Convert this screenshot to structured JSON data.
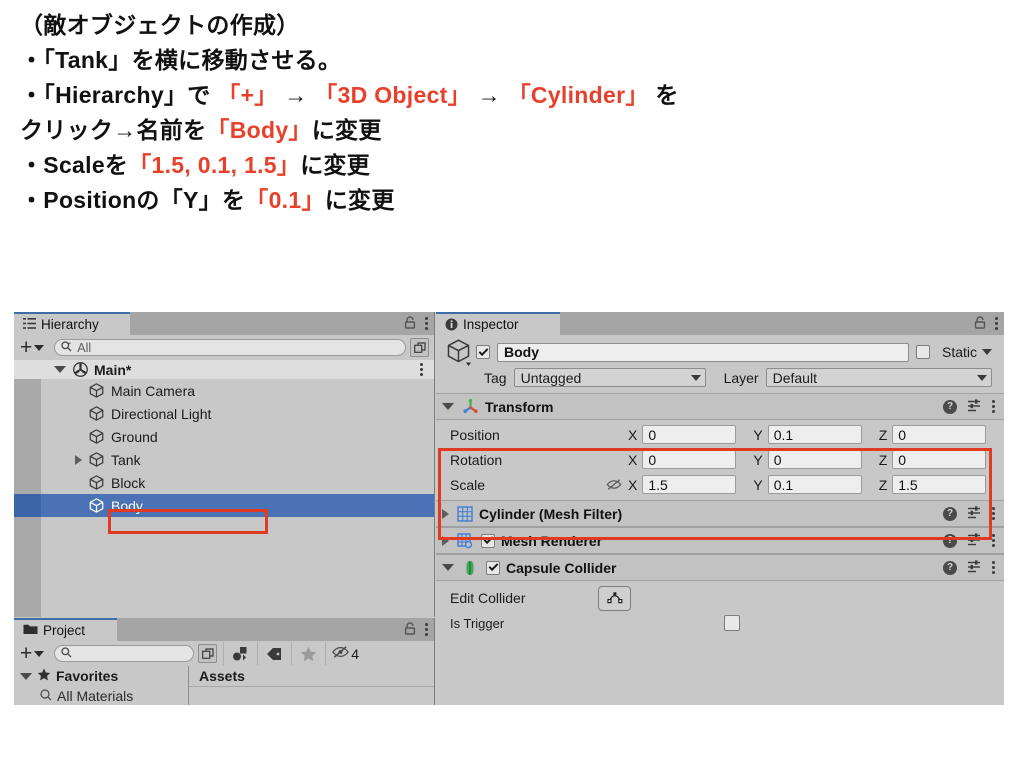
{
  "slide": {
    "lines": [
      [
        {
          "t": "（敵オブジェクトの作成）",
          "c": "black"
        }
      ],
      [
        {
          "t": "・「Tank」を横に移動させる。",
          "c": "black"
        }
      ],
      [
        {
          "t": "・「Hierarchy」で ",
          "c": "black"
        },
        {
          "t": "「+」",
          "c": "red"
        },
        {
          "t": " → ",
          "c": "black"
        },
        {
          "t": "「3D Object」",
          "c": "red"
        },
        {
          "t": " → ",
          "c": "black"
        },
        {
          "t": "「Cylinder」",
          "c": "red"
        },
        {
          "t": " を",
          "c": "black"
        }
      ],
      [
        {
          "t": "クリック→名前を",
          "c": "black"
        },
        {
          "t": "「Body」",
          "c": "red"
        },
        {
          "t": "に変更",
          "c": "black"
        }
      ],
      [
        {
          "t": "・Scaleを",
          "c": "black"
        },
        {
          "t": "「1.5, 0.1, 1.5」",
          "c": "red"
        },
        {
          "t": "に変更",
          "c": "black"
        }
      ],
      [
        {
          "t": "・Positionの「Y」を",
          "c": "black"
        },
        {
          "t": "「0.1」",
          "c": "red"
        },
        {
          "t": "に変更",
          "c": "black"
        }
      ]
    ],
    "accent_red": "#e8402a",
    "text_color": "#111111"
  },
  "hierarchy": {
    "tab_label": "Hierarchy",
    "tab_icon": "hierarchy-icon",
    "lock_icon": "lock-icon",
    "menu_icon": "kebab-menu-icon",
    "add_label": "+",
    "search_placeholder": "All",
    "search_icon": "search-icon",
    "expand_icon": "expand-window-icon",
    "scene": {
      "name": "Main*",
      "icon": "unity-scene-icon",
      "expanded": true
    },
    "items": [
      {
        "label": "Main Camera",
        "icon": "gameobject-cube-icon",
        "indent": 2,
        "arrow": false,
        "selected": false
      },
      {
        "label": "Directional Light",
        "icon": "gameobject-cube-icon",
        "indent": 2,
        "arrow": false,
        "selected": false
      },
      {
        "label": "Ground",
        "icon": "gameobject-cube-icon",
        "indent": 2,
        "arrow": false,
        "selected": false
      },
      {
        "label": "Tank",
        "icon": "gameobject-cube-icon",
        "indent": 2,
        "arrow": true,
        "selected": false
      },
      {
        "label": "Block",
        "icon": "gameobject-cube-icon",
        "indent": 2,
        "arrow": false,
        "selected": false
      },
      {
        "label": "Body",
        "icon": "gameobject-cube-icon",
        "indent": 2,
        "arrow": false,
        "selected": true
      }
    ],
    "selection_color": "#4a72b5",
    "highlight_box_color": "#e03a20"
  },
  "project": {
    "tab_label": "Project",
    "tab_icon": "folder-icon",
    "lock_icon": "lock-icon",
    "menu_icon": "kebab-menu-icon",
    "add_label": "+",
    "search_placeholder": "",
    "search_icon": "search-icon",
    "expand_icon": "expand-window-icon",
    "filter_buttons": [
      {
        "icon": "asset-type-filter-icon",
        "label": ""
      },
      {
        "icon": "label-tag-filter-icon",
        "label": ""
      },
      {
        "icon": "star-favorite-icon",
        "label": ""
      },
      {
        "icon": "hidden-packages-icon",
        "label": "4"
      }
    ],
    "tree": {
      "favorites_label": "Favorites",
      "favorites_icon": "star-favorite-icon",
      "favorites_child": "All Materials",
      "assets_header": "Assets"
    }
  },
  "inspector": {
    "tab_label": "Inspector",
    "tab_icon": "info-icon",
    "lock_icon": "lock-icon",
    "menu_icon": "kebab-menu-icon",
    "gameobject": {
      "icon": "gameobject-cube-icon",
      "enabled": true,
      "name": "Body",
      "static_label": "Static",
      "static_checked": false,
      "tag_label": "Tag",
      "tag_value": "Untagged",
      "layer_label": "Layer",
      "layer_value": "Default"
    },
    "transform": {
      "title": "Transform",
      "icon": "transform-axes-icon",
      "expanded": true,
      "help_icon": "help-icon",
      "preset_icon": "preset-sliders-icon",
      "menu_icon": "kebab-menu-icon",
      "rows": [
        {
          "name": "Position",
          "link_icon": "",
          "x": "0",
          "y": "0.1",
          "z": "0"
        },
        {
          "name": "Rotation",
          "link_icon": "",
          "x": "0",
          "y": "0",
          "z": "0"
        },
        {
          "name": "Scale",
          "link_icon": "constrain-proportions-off-icon",
          "x": "1.5",
          "y": "0.1",
          "z": "1.5"
        }
      ],
      "axis_labels": [
        "X",
        "Y",
        "Z"
      ]
    },
    "components": [
      {
        "title": "Cylinder (Mesh Filter)",
        "icon": "mesh-filter-icon",
        "expanded": false,
        "has_checkbox": false,
        "checked": false
      },
      {
        "title": "Mesh Renderer",
        "icon": "mesh-renderer-icon",
        "expanded": false,
        "has_checkbox": true,
        "checked": true
      },
      {
        "title": "Capsule Collider",
        "icon": "capsule-collider-icon",
        "expanded": true,
        "has_checkbox": true,
        "checked": true
      }
    ],
    "capsule_collider": {
      "edit_collider_label": "Edit Collider",
      "edit_collider_icon": "edit-collider-icon",
      "is_trigger_label": "Is Trigger"
    },
    "highlight_box_color": "#e03a20"
  }
}
